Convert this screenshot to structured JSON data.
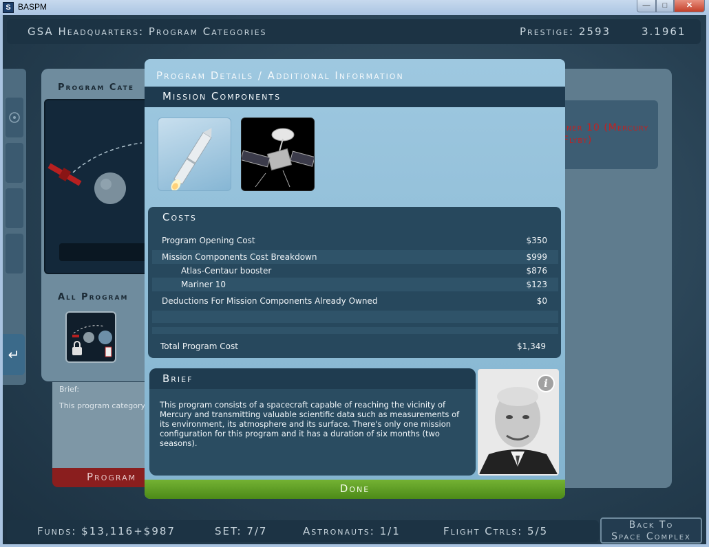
{
  "window": {
    "title": "BASPM",
    "icon_letter": "S"
  },
  "header": {
    "title": "GSA Headquarters:  Program Categories",
    "prestige": "Prestige: 2593",
    "version": "3.1961"
  },
  "background": {
    "program_categories_label": "Program Cate",
    "all_programs_label": "All Program",
    "brief_label": "Brief:",
    "brief_text": "This program category Mercury by sending an environment, atmosphe",
    "red_button_label": "Program",
    "selected_program_line1": "Mariner 10 (Mercury",
    "selected_program_line2": "Flyby)"
  },
  "modal": {
    "title": "Program Details / Additional Information",
    "components_title": "Mission Components",
    "costs": {
      "title": "Costs",
      "rows": [
        {
          "label": "Program Opening Cost",
          "value": "$350"
        },
        {
          "label": "Mission Components Cost Breakdown",
          "value": "$999"
        },
        {
          "label": "Atlas-Centaur booster",
          "value": "$876"
        },
        {
          "label": "Mariner 10",
          "value": "$123"
        },
        {
          "label": "Deductions For Mission Components Already Owned",
          "value": "$0"
        }
      ],
      "total_label": "Total Program Cost",
      "total_value": "$1,349"
    },
    "brief": {
      "title": "Brief",
      "text": "This program consists of a spacecraft capable of reaching the vicinity of Mercury and transmitting valuable scientific data such as measurements of its environment, its atmosphere and its surface. There's only one mission configuration for this program and it has a duration of six months (two seasons)."
    },
    "done_label": "Done"
  },
  "status": {
    "funds": "Funds: $13,116+$987",
    "set": "SET: 7/7",
    "astronauts": "Astronauts: 1/1",
    "flight_ctrls": "Flight Ctrls: 5/5"
  },
  "back_button": {
    "line1": "Back To",
    "line2": "Space Complex"
  },
  "icons": {
    "info": "info-icon",
    "return": "return-arrow-icon",
    "lock": "lock-icon"
  },
  "colors": {
    "done_green": "#5f9e22",
    "modal_blue": "#8fbcd7",
    "dark_panel": "#27485d",
    "red_accent": "#c42020"
  }
}
